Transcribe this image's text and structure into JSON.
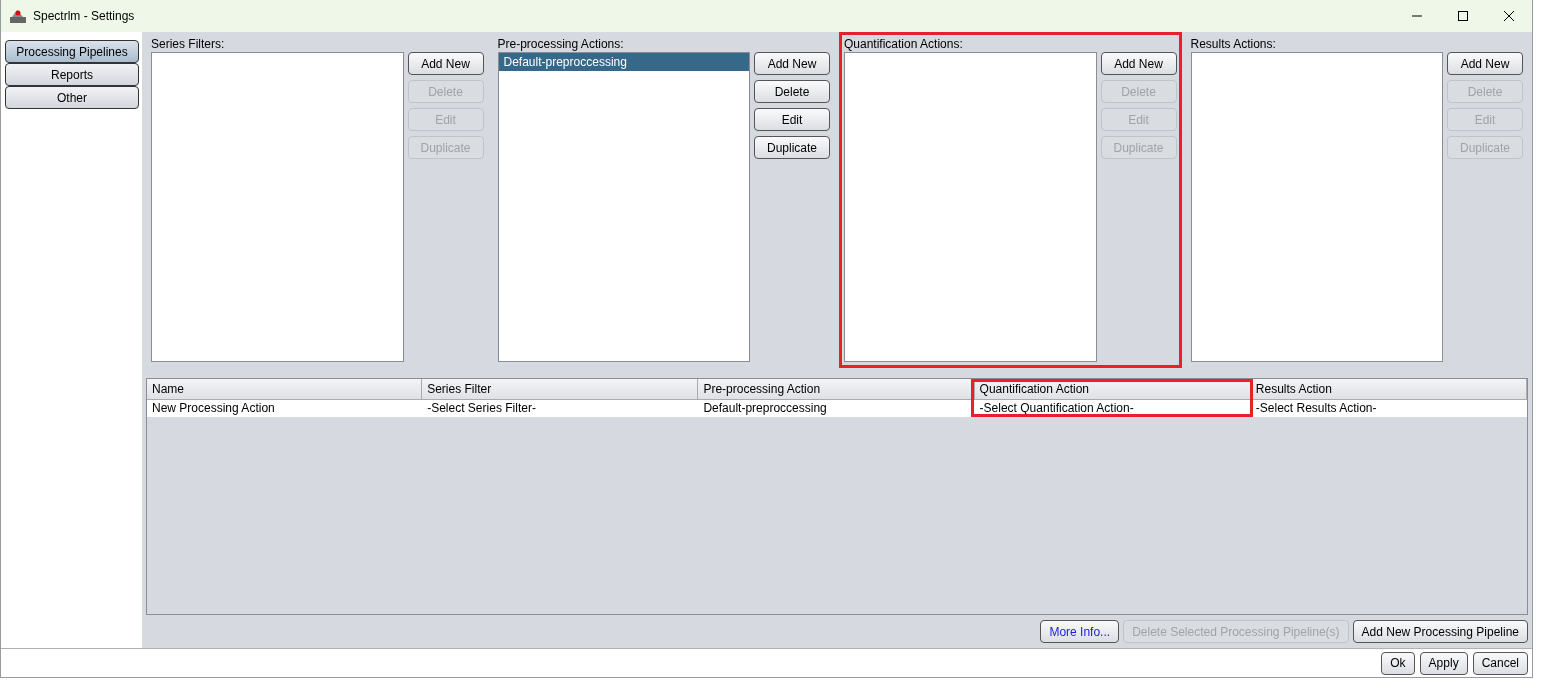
{
  "window": {
    "title": "Spectrlm - Settings"
  },
  "sidebar": {
    "tabs": [
      {
        "label": "Processing Pipelines",
        "selected": true
      },
      {
        "label": "Reports",
        "selected": false
      },
      {
        "label": "Other",
        "selected": false
      }
    ]
  },
  "panels": [
    {
      "label": "Series Filters:",
      "highlighted": false,
      "buttons": [
        {
          "label": "Add New",
          "disabled": false
        },
        {
          "label": "Delete",
          "disabled": true
        },
        {
          "label": "Edit",
          "disabled": true
        },
        {
          "label": "Duplicate",
          "disabled": true
        }
      ]
    },
    {
      "label": "Pre-processing Actions:",
      "highlighted": false,
      "items": [
        {
          "label": "Default-preproccessing",
          "selected": true
        }
      ],
      "buttons": [
        {
          "label": "Add New",
          "disabled": false
        },
        {
          "label": "Delete",
          "disabled": false
        },
        {
          "label": "Edit",
          "disabled": false
        },
        {
          "label": "Duplicate",
          "disabled": false
        }
      ]
    },
    {
      "label": "Quantification Actions:",
      "highlighted": true,
      "buttons": [
        {
          "label": "Add New",
          "disabled": false
        },
        {
          "label": "Delete",
          "disabled": true
        },
        {
          "label": "Edit",
          "disabled": true
        },
        {
          "label": "Duplicate",
          "disabled": true
        }
      ]
    },
    {
      "label": "Results Actions:",
      "highlighted": false,
      "buttons": [
        {
          "label": "Add New",
          "disabled": false
        },
        {
          "label": "Delete",
          "disabled": true
        },
        {
          "label": "Edit",
          "disabled": true
        },
        {
          "label": "Duplicate",
          "disabled": true
        }
      ]
    }
  ],
  "table": {
    "columns": [
      {
        "label": "Name",
        "highlighted": false
      },
      {
        "label": "Series Filter",
        "highlighted": false
      },
      {
        "label": "Pre-processing Action",
        "highlighted": false
      },
      {
        "label": "Quantification Action",
        "highlighted": true
      },
      {
        "label": "Results Action",
        "highlighted": false
      }
    ],
    "rows": [
      [
        "New Processing Action",
        "-Select Series Filter-",
        "Default-preproccessing",
        "-Select Quantification Action-",
        "-Select Results Action-"
      ]
    ]
  },
  "actions": [
    {
      "label": "More Info...",
      "kind": "info",
      "disabled": false
    },
    {
      "label": "Delete Selected Processing Pipeline(s)",
      "kind": "plain",
      "disabled": true
    },
    {
      "label": "Add New Processing Pipeline",
      "kind": "plain",
      "disabled": false
    }
  ],
  "footer_buttons": [
    "Ok",
    "Apply",
    "Cancel"
  ]
}
